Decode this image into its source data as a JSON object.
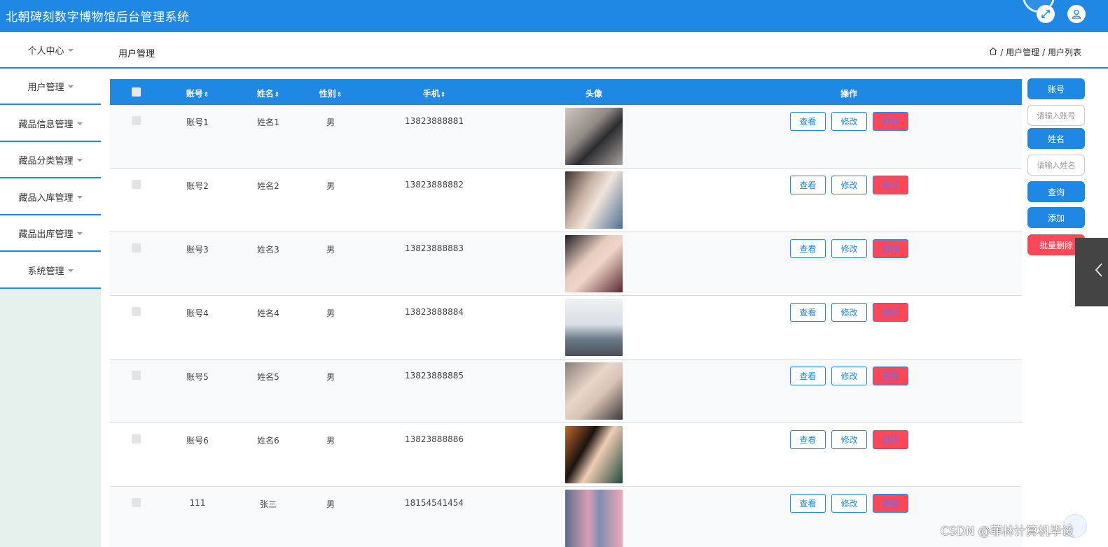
{
  "app": {
    "title": "北朝碑刻数字博物馆后台管理系统"
  },
  "sidebar": {
    "items": [
      {
        "label": "个人中心"
      },
      {
        "label": "用户管理"
      },
      {
        "label": "藏品信息管理"
      },
      {
        "label": "藏品分类管理"
      },
      {
        "label": "藏品入库管理"
      },
      {
        "label": "藏品出库管理"
      },
      {
        "label": "系统管理"
      }
    ]
  },
  "header": {
    "page_title": "用户管理",
    "breadcrumb": [
      "/ 用户管理",
      "/ 用户列表"
    ]
  },
  "table": {
    "columns": {
      "account": "账号",
      "name": "姓名",
      "gender": "性别",
      "phone": "手机",
      "avatar": "头像",
      "actions": "操作"
    },
    "sort_glyph": "⇕",
    "rows": [
      {
        "account": "账号1",
        "name": "姓名1",
        "gender": "男",
        "phone": "13823888881"
      },
      {
        "account": "账号2",
        "name": "姓名2",
        "gender": "男",
        "phone": "13823888882"
      },
      {
        "account": "账号3",
        "name": "姓名3",
        "gender": "男",
        "phone": "13823888883"
      },
      {
        "account": "账号4",
        "name": "姓名4",
        "gender": "男",
        "phone": "13823888884"
      },
      {
        "account": "账号5",
        "name": "姓名5",
        "gender": "男",
        "phone": "13823888885"
      },
      {
        "account": "账号6",
        "name": "姓名6",
        "gender": "男",
        "phone": "13823888886"
      },
      {
        "account": "111",
        "name": "张三",
        "gender": "男",
        "phone": "18154541454"
      }
    ],
    "actions": {
      "view": "查看",
      "edit": "修改",
      "delete": "删除"
    }
  },
  "search_panel": {
    "account_label": "账号",
    "account_placeholder": "请输入账号",
    "name_label": "姓名",
    "name_placeholder": "请输入姓名",
    "query_button": "查询",
    "add_button": "添加",
    "batch_delete_button": "批量删除"
  },
  "watermark": "CSDN @菲林计算机毕设",
  "colors": {
    "primary": "#1f88e5",
    "danger": "#ff4757",
    "sidebar_bg": "#e6f0ec"
  },
  "icons": [
    "fullscreen-icon",
    "user-icon",
    "home-icon",
    "chevron-left-icon",
    "caret-down-icon"
  ]
}
